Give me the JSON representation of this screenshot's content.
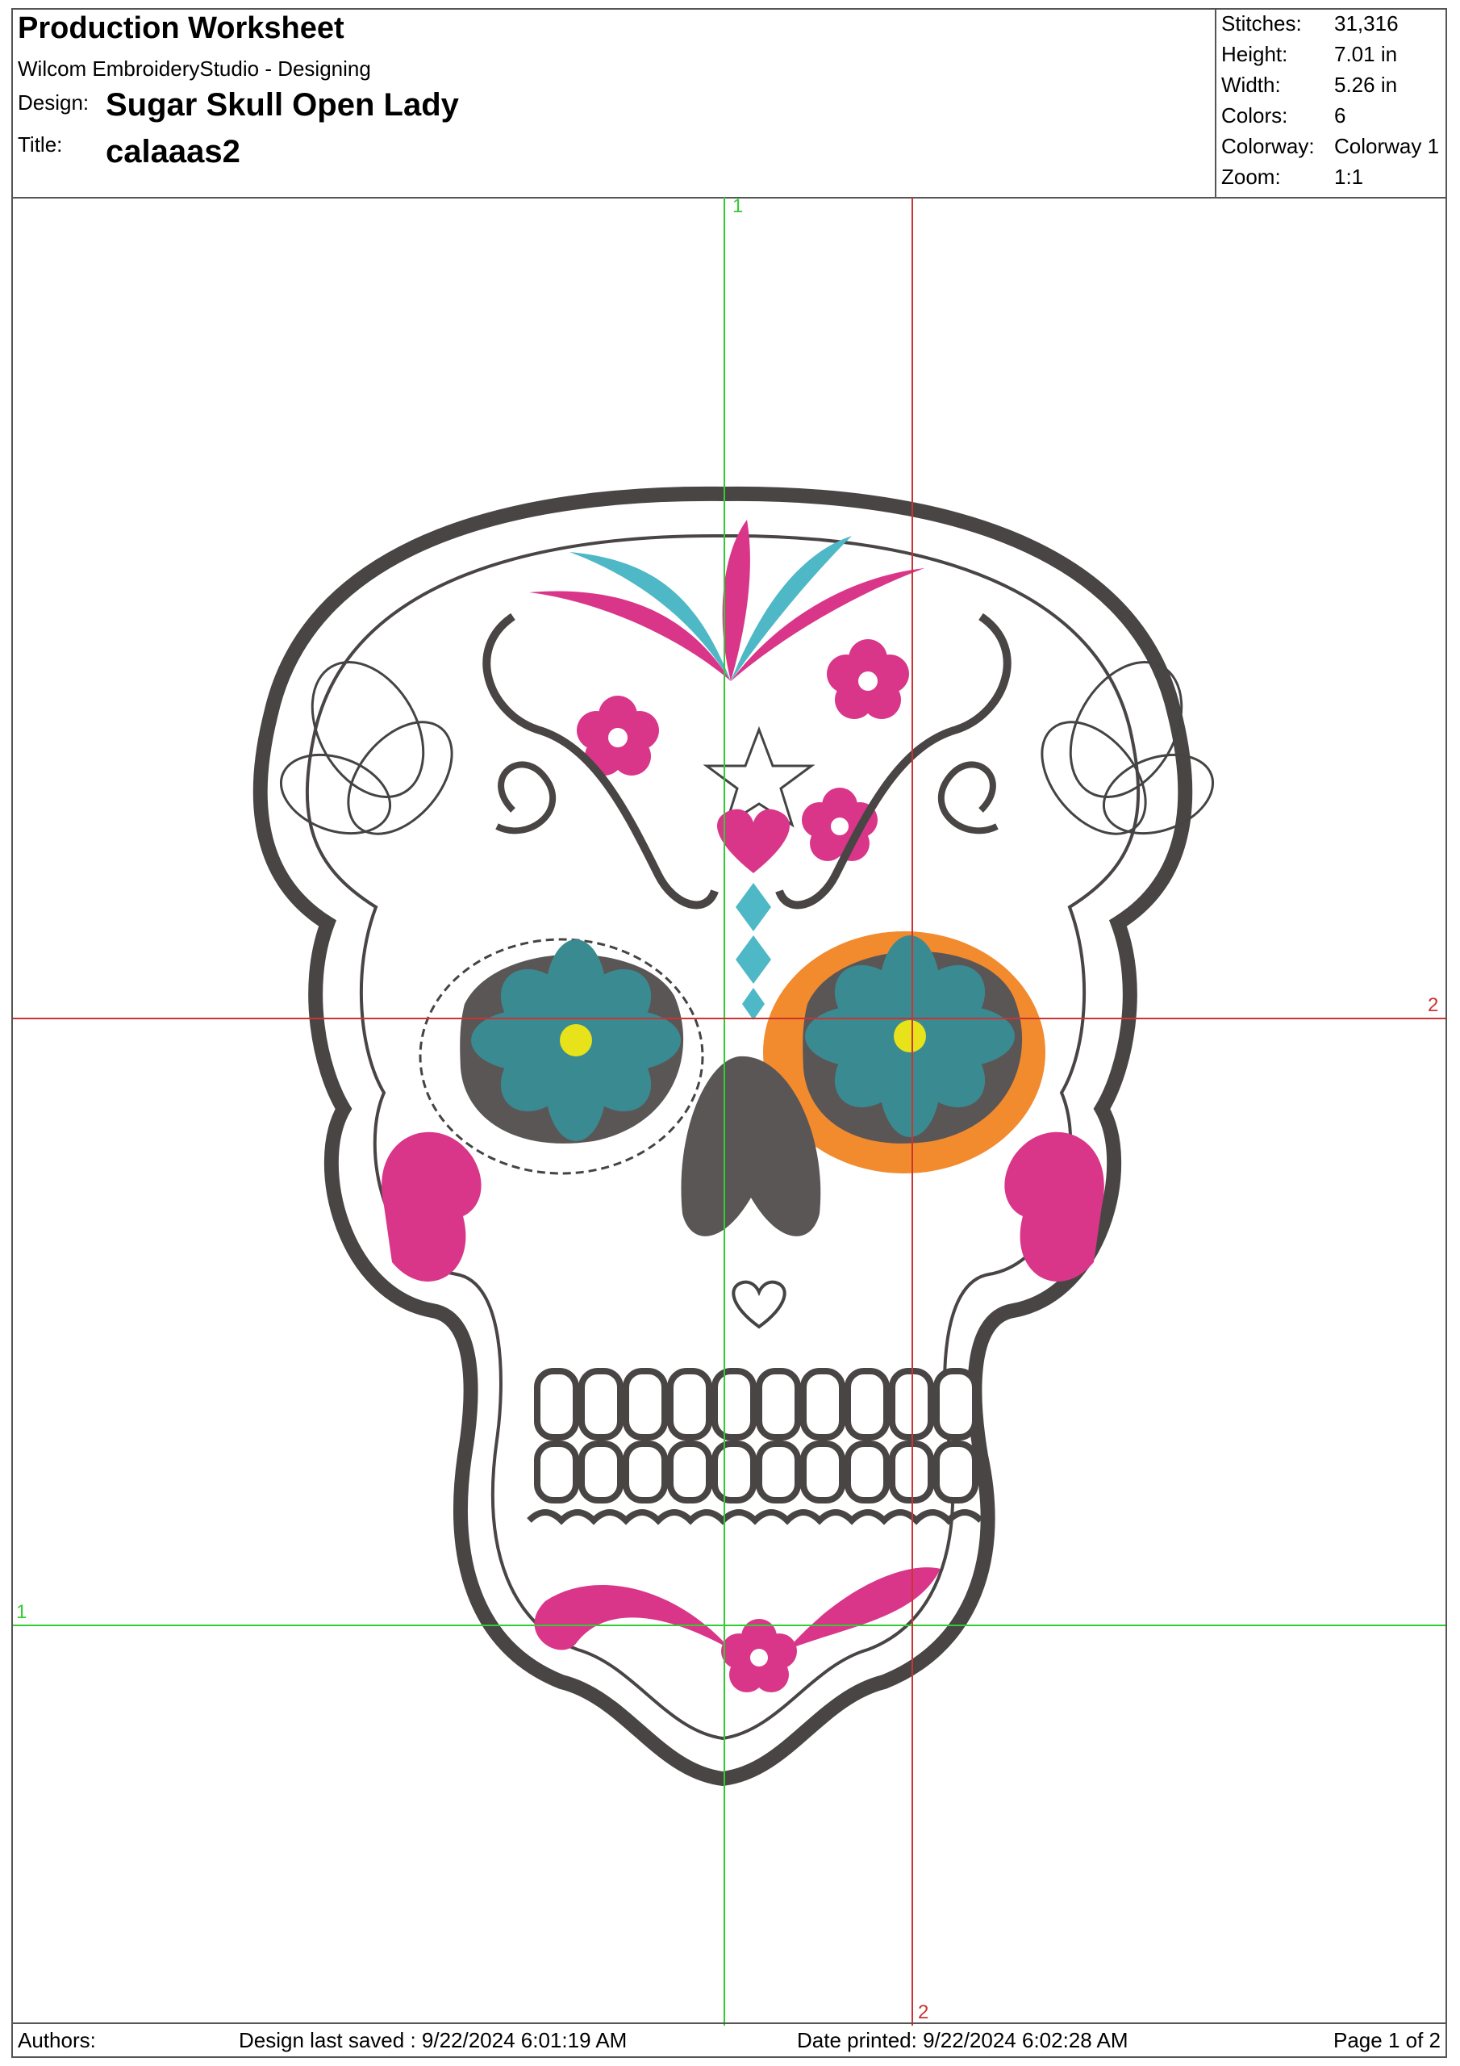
{
  "header": {
    "title": "Production Worksheet",
    "app": "Wilcom EmbroideryStudio - Designing",
    "design_label": "Design:",
    "design_value": "Sugar Skull Open Lady",
    "title_label": "Title:",
    "title_value": "calaaas2"
  },
  "stats": [
    {
      "label": "Stitches:",
      "value": "31,316"
    },
    {
      "label": "Height:",
      "value": "7.01 in"
    },
    {
      "label": "Width:",
      "value": "5.26 in"
    },
    {
      "label": "Colors:",
      "value": "6"
    },
    {
      "label": "Colorway:",
      "value": "Colorway 1"
    },
    {
      "label": "Zoom:",
      "value": "1:1"
    }
  ],
  "guides": {
    "green_top": "1",
    "green_left": "1",
    "red_right": "2",
    "red_bottom": "2"
  },
  "footer": {
    "authors": "Authors:",
    "saved": "Design last saved : 9/22/2024 6:01:19 AM",
    "printed": "Date printed: 9/22/2024 6:02:28 AM",
    "page": "Page 1 of 2"
  },
  "colors": {
    "outline": "#4a4545",
    "pink": "#d9368a",
    "teal": "#3a8a92",
    "cyan": "#4fb8c6",
    "orange": "#f28a2e",
    "yellow": "#e8e21a",
    "guide_green": "#33cc33",
    "guide_red": "#cc3333"
  }
}
